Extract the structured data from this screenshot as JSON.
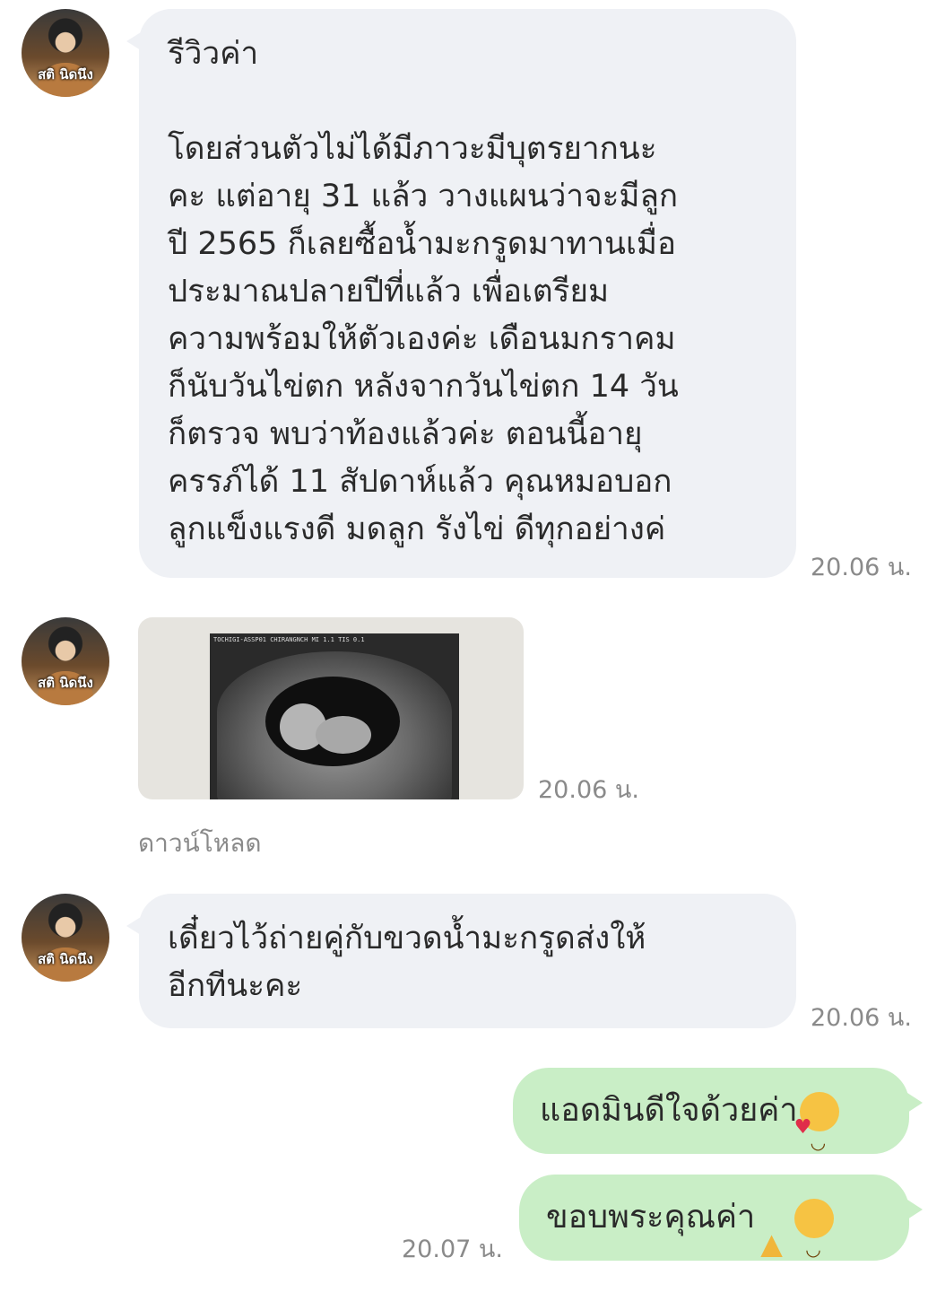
{
  "contact": {
    "avatar_name": "สติ นิดนึง"
  },
  "messages": [
    {
      "lines": [
        "รีวิวค่า",
        "",
        "โดยส่วนตัวไม่ได้มีภาวะมีบุตรยากนะ",
        "คะ แต่อายุ 31 แล้ว วางแผนว่าจะมีลูก",
        "ปี 2565 ก็เลยซื้อน้ำมะกรูดมาทานเมื่อ",
        "ประมาณปลายปีที่แล้ว เพื่อเตรียม",
        "ความพร้อมให้ตัวเองค่ะ เดือนมกราคม",
        "ก็นับวันไข่ตก หลังจากวันไข่ตก 14 วัน",
        "ก็ตรวจ พบว่าท้องแล้วค่ะ ตอนนี้อายุ",
        "ครรภ์ได้ 11 สัปดาห์แล้ว คุณหมอบอก",
        "ลูกแข็งแรงดี มดลูก รังไข่ ดีทุกอย่างค่"
      ],
      "time": "20.06 น."
    },
    {
      "type": "image",
      "image_header": "TOCHIGI-ASSP01  CHIRANGNCH  MI 1.1  TIS 0.1",
      "time": "20.06 น.",
      "download": "ดาวน์โหลด"
    },
    {
      "lines": [
        "เดี๋ยวไว้ถ่ายคู่กับขวดน้ำมะกรูดส่งให้",
        "อีกทีนะคะ"
      ],
      "time": "20.06 น."
    }
  ],
  "replies": [
    {
      "text": "แอดมินดีใจด้วยค่า",
      "emoji": "smiling-face-with-hearts"
    },
    {
      "text": "ขอบพระคุณค่า",
      "emoji": "folded-hands + smiling-face"
    }
  ],
  "reply_time": "20.07 น."
}
